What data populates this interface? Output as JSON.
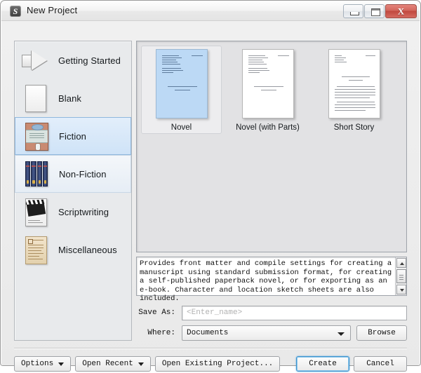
{
  "window": {
    "title": "New Project",
    "app_icon": "scrivener-s-icon",
    "controls": {
      "minimize": "minimize-icon",
      "maximize": "maximize-icon",
      "close": "X"
    }
  },
  "sidebar": {
    "items": [
      {
        "label": "Getting Started",
        "icon": "arrow-icon",
        "state": "normal"
      },
      {
        "label": "Blank",
        "icon": "blank-page-icon",
        "state": "normal"
      },
      {
        "label": "Fiction",
        "icon": "book-cover-icon",
        "state": "selected"
      },
      {
        "label": "Non-Fiction",
        "icon": "book-spines-icon",
        "state": "hovered"
      },
      {
        "label": "Scriptwriting",
        "icon": "clapperboard-icon",
        "state": "normal"
      },
      {
        "label": "Miscellaneous",
        "icon": "parchment-icon",
        "state": "normal"
      }
    ]
  },
  "templates": {
    "items": [
      {
        "name": "Novel",
        "state": "selected"
      },
      {
        "name": "Novel (with Parts)",
        "state": "normal"
      },
      {
        "name": "Short Story",
        "state": "normal"
      }
    ]
  },
  "description": {
    "text": "Provides front matter and compile settings for creating a manuscript using standard submission format, for creating a self-published paperback novel, or for exporting as an e-book. Character and location sketch sheets are also included.",
    "scrollbar": {
      "up": "scroll-up-arrow",
      "down": "scroll-down-arrow"
    }
  },
  "form": {
    "save_as_label": "Save As:",
    "save_as_placeholder": "<Enter_name>",
    "save_as_value": "",
    "where_label": "Where:",
    "where_value": "Documents",
    "browse_label": "Browse"
  },
  "footer": {
    "options_label": "Options",
    "open_recent_label": "Open Recent",
    "open_existing_label": "Open Existing Project...",
    "create_label": "Create",
    "cancel_label": "Cancel"
  },
  "colors": {
    "selection_blue": "#cfe3f7",
    "selection_border": "#8fb7dd",
    "thumb_selected": "#bcd9f5",
    "default_button_focus": "#3d94d0",
    "close_button_red": "#c0483e"
  }
}
